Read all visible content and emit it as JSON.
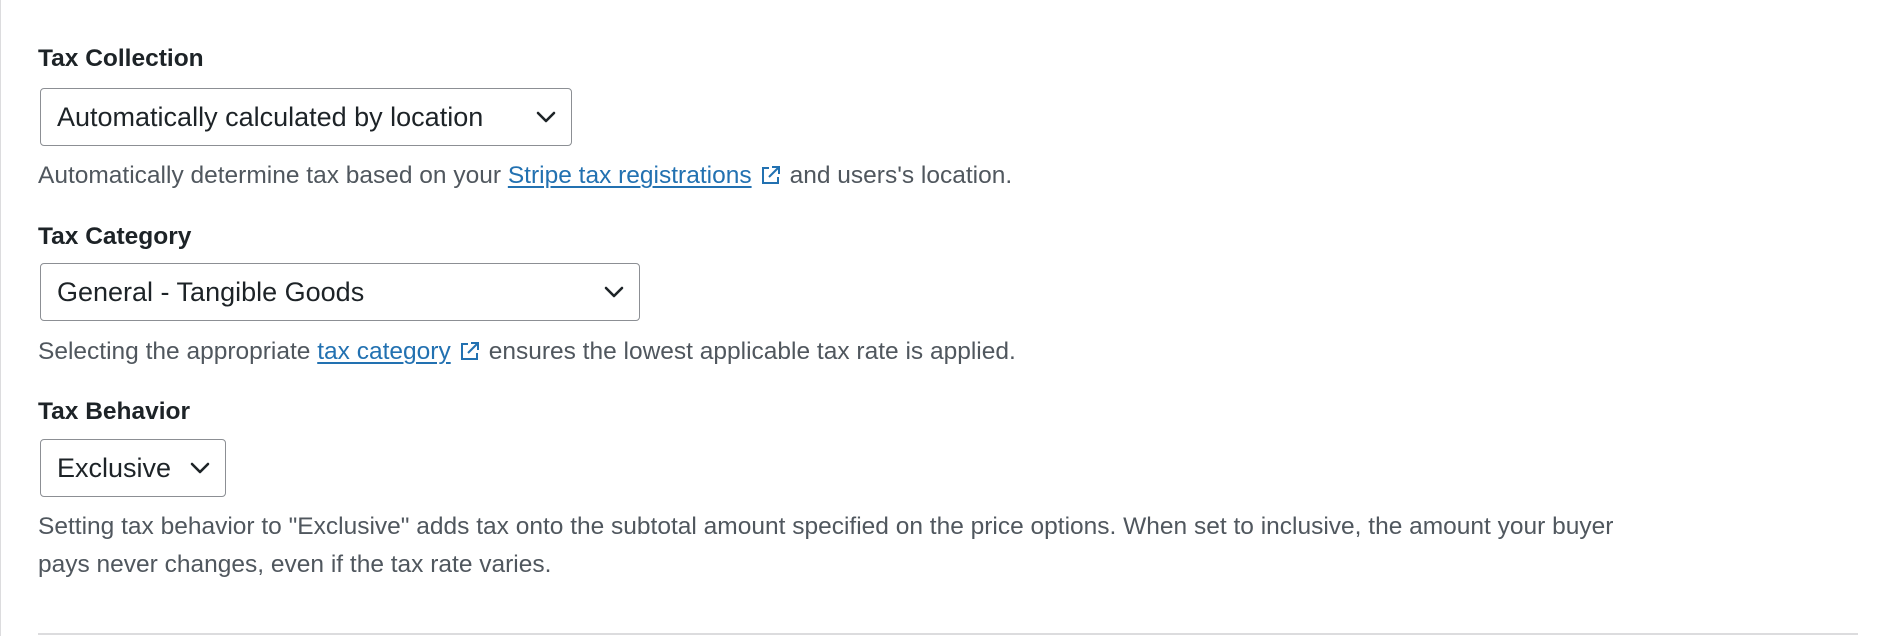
{
  "tax_collection": {
    "label": "Tax Collection",
    "selected": "Automatically calculated by location",
    "help_before": "Automatically determine tax based on your",
    "help_link": "Stripe tax registrations",
    "help_after": "and users's location."
  },
  "tax_category": {
    "label": "Tax Category",
    "selected": "General - Tangible Goods",
    "help_before": "Selecting the appropriate",
    "help_link": "tax category",
    "help_after": "ensures the lowest applicable tax rate is applied."
  },
  "tax_behavior": {
    "label": "Tax Behavior",
    "selected": "Exclusive",
    "help_line1": "Setting tax behavior to \"Exclusive\" adds tax onto the subtotal amount specified on the price options. When set to inclusive, the amount your buyer",
    "help_line2": "pays never changes, even if the tax rate varies."
  },
  "icons": {
    "select_chevron": "chevron-down-icon",
    "external_link": "external-link-icon"
  },
  "colors": {
    "link": "#2271b1",
    "help_text": "#50575e",
    "label_text": "#1d2327",
    "border": "#8c8f94"
  }
}
